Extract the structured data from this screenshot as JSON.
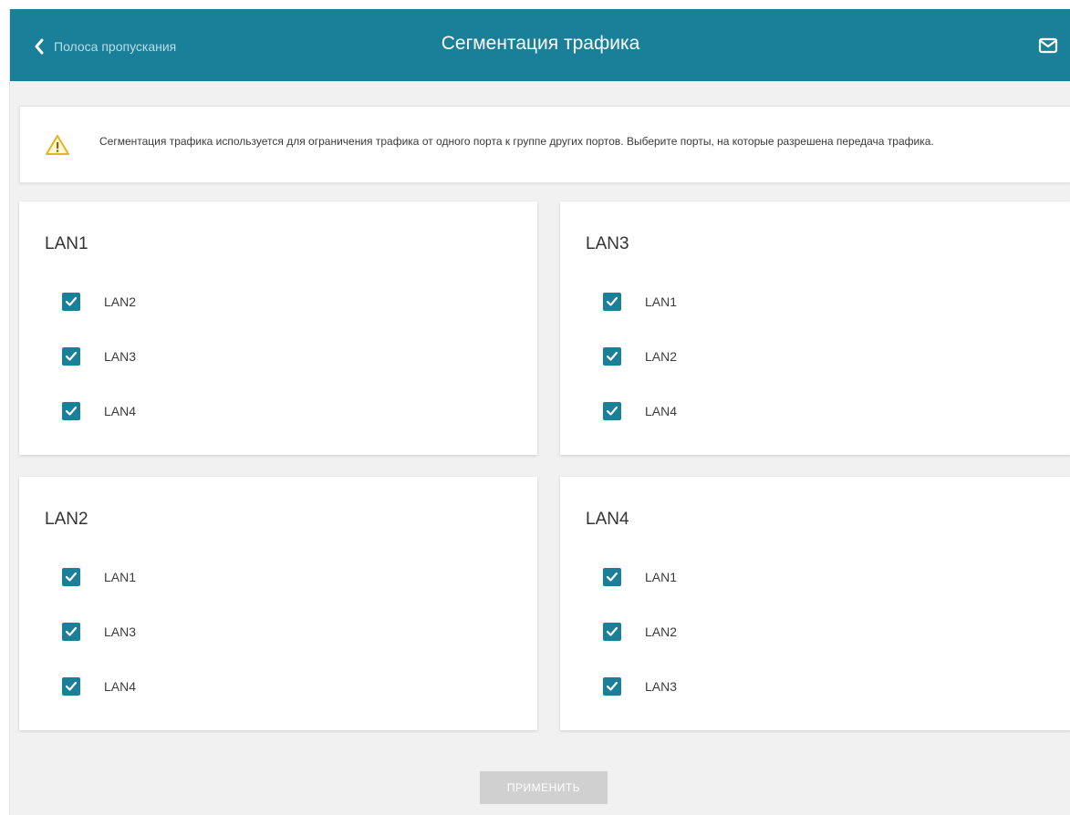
{
  "header": {
    "back_label": "Полоса пропускания",
    "title": "Сегментация трафика",
    "mail_icon": "mail-icon",
    "accent_color": "#1a7f98"
  },
  "info": {
    "icon": "warning-icon",
    "text": "Сегментация трафика используется для ограничения трафика от одного порта к группе других портов. Выберите порты, на которые разрешена передача трафика."
  },
  "cards": [
    {
      "title": "LAN1",
      "ports": [
        {
          "label": "LAN2",
          "checked": true
        },
        {
          "label": "LAN3",
          "checked": true
        },
        {
          "label": "LAN4",
          "checked": true
        }
      ]
    },
    {
      "title": "LAN3",
      "ports": [
        {
          "label": "LAN1",
          "checked": true
        },
        {
          "label": "LAN2",
          "checked": true
        },
        {
          "label": "LAN4",
          "checked": true
        }
      ]
    },
    {
      "title": "LAN2",
      "ports": [
        {
          "label": "LAN1",
          "checked": true
        },
        {
          "label": "LAN3",
          "checked": true
        },
        {
          "label": "LAN4",
          "checked": true
        }
      ]
    },
    {
      "title": "LAN4",
      "ports": [
        {
          "label": "LAN1",
          "checked": true
        },
        {
          "label": "LAN2",
          "checked": true
        },
        {
          "label": "LAN3",
          "checked": true
        }
      ]
    }
  ],
  "apply_label": "Применить"
}
